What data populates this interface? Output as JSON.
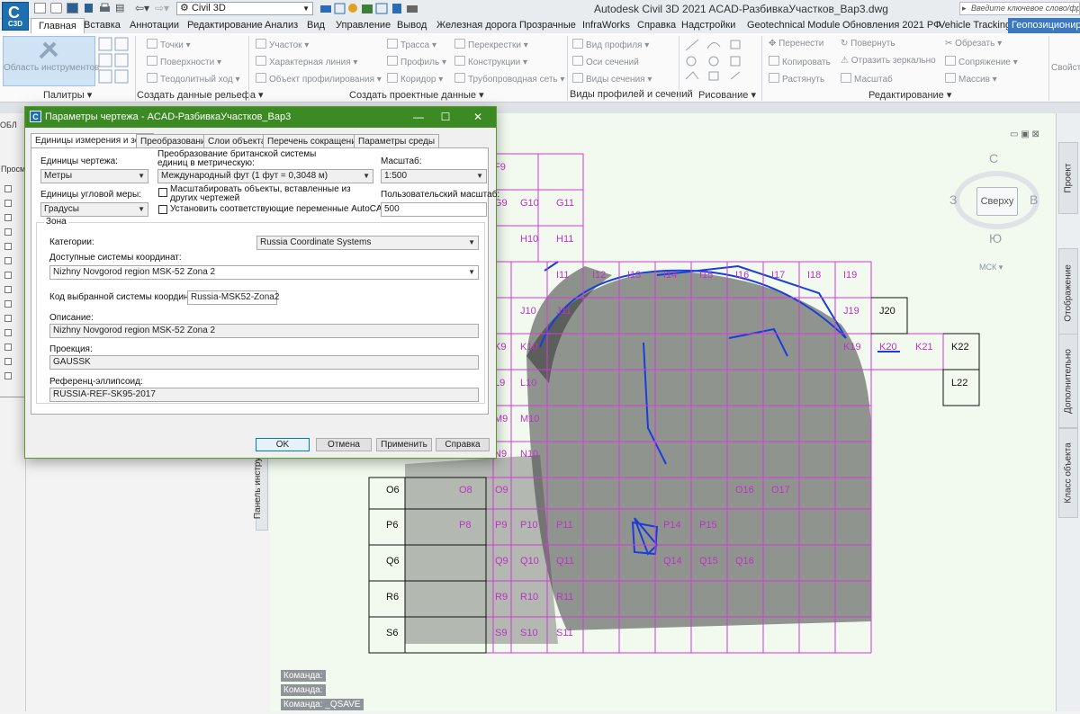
{
  "app": {
    "logo_letter": "C",
    "logo_text": "C3D",
    "workspace": "Civil 3D",
    "title": "Autodesk Civil 3D 2021    ACAD-РазбивкаУчастков_Вар3.dwg",
    "search_placeholder": "Введите ключевое слово/фразу"
  },
  "ribbon": {
    "tabs": [
      "Главная",
      "Вставка",
      "Аннотации",
      "Редактирование",
      "Анализ",
      "Вид",
      "Управление",
      "Вывод",
      "Железная дорога",
      "Прозрачные",
      "InfraWorks",
      "Справка",
      "Надстройки",
      "Geotechnical Module",
      "Обновления 2021 РФ",
      "Vehicle Tracking",
      "Геопозиционир"
    ],
    "palettes": {
      "big_button": "Область инструментов",
      "title": "Палитры ▾"
    },
    "terrain": {
      "items": [
        "Точки ▾",
        "Поверхности ▾",
        "Теодолитный ход ▾"
      ],
      "title": "Создать данные рельефа ▾"
    },
    "design": {
      "items": [
        "Участок ▾",
        "Характерная линия ▾",
        "Объект профилирования ▾",
        "Трасса ▾",
        "Профиль ▾",
        "Коридор ▾",
        "Перекрестки ▾",
        "Конструкции ▾",
        "Трубопроводная сеть ▾"
      ],
      "title": "Создать проектные данные ▾"
    },
    "profiles": {
      "items": [
        "Вид профиля ▾",
        "Оси сечений",
        "Виды сечения ▾"
      ],
      "title": "Виды профилей и сечений"
    },
    "draw": {
      "title": "Рисование ▾"
    },
    "edit": {
      "items": [
        "Перенести",
        "Повернуть",
        "Копировать",
        "Отразить зеркально",
        "Растянуть",
        "Масштаб",
        "Обрезать ▾",
        "Сопряжение ▾",
        "Массив ▾"
      ],
      "title": "Редактирование ▾"
    },
    "extra": {
      "item": "Свойст"
    }
  },
  "left_panel": {
    "tab_label": "ОБЛ",
    "sub_label": "Просм",
    "vertical_tab": "Панель инструм"
  },
  "viewcube": {
    "north": "С",
    "south": "Ю",
    "west": "З",
    "east": "В",
    "face": "Сверху",
    "ucs": "МСК ▾"
  },
  "right_panel": {
    "tabs": [
      "Проект",
      "Отображение",
      "Дополнительно",
      "Класс объекта"
    ]
  },
  "command_line": [
    "Команда:",
    "Команда:",
    "Команда:  _QSAVE"
  ],
  "dialog": {
    "title": "Параметры чертежа - ACAD-РазбивкаУчастков_Вар3",
    "tabs": [
      "Единицы измерения и зона",
      "Преобразование",
      "Слои объекта",
      "Перечень сокращений",
      "Параметры среды"
    ],
    "drawing_units_label": "Единицы чертежа:",
    "drawing_units_value": "Метры",
    "imperial_label": "Преобразование британской системы единиц в метрическую:",
    "imperial_value": "Международный фут (1 фут = 0,3048 м)",
    "scale_label": "Масштаб:",
    "scale_value": "1:500",
    "angular_label": "Единицы угловой меры:",
    "angular_value": "Градусы",
    "scale_objects_label": "Масштабировать объекты, вставленные из других чертежей",
    "set_vars_label": "Установить соответствующие переменные AutoCAD",
    "custom_scale_label": "Пользовательский масштаб:",
    "custom_scale_value": "500",
    "zone_title": "Зона",
    "categories_label": "Категории:",
    "categories_value": "Russia Coordinate Systems",
    "available_label": "Доступные системы координат:",
    "available_value": "Nizhny Novgorod region MSK-52 Zona 2",
    "code_label": "Код выбранной системы координат:",
    "code_value": "Russia-MSK52-Zona2",
    "description_label": "Описание:",
    "description_value": "Nizhny Novgorod region MSK-52 Zona 2",
    "projection_label": "Проекция:",
    "projection_value": "GAUSSK",
    "ellipsoid_label": "Референц-эллипсоид:",
    "ellipsoid_value": "RUSSIA-REF-SK95-2017",
    "buttons": {
      "ok": "OK",
      "cancel": "Отмена",
      "apply": "Применить",
      "help": "Справка"
    }
  },
  "sheet_grid": {
    "labels": [
      "F9",
      "G9",
      "G10",
      "G11",
      "H10",
      "H11",
      "I11",
      "I12",
      "I13",
      "I14",
      "I15",
      "I16",
      "I17",
      "I18",
      "I19",
      "J10",
      "J11",
      "J19",
      "J20",
      "K9",
      "K10",
      "K19",
      "K20",
      "K21",
      "K22",
      "L9",
      "L10",
      "L22",
      "M9",
      "M10",
      "N9",
      "N10",
      "O6",
      "O8",
      "O9",
      "O16",
      "O17",
      "P6",
      "P8",
      "P9",
      "P10",
      "P11",
      "P14",
      "P15",
      "Q6",
      "Q9",
      "Q10",
      "Q11",
      "Q14",
      "Q15",
      "Q16",
      "R6",
      "R9",
      "R10",
      "R11",
      "S6",
      "S9",
      "S10",
      "S11"
    ]
  }
}
